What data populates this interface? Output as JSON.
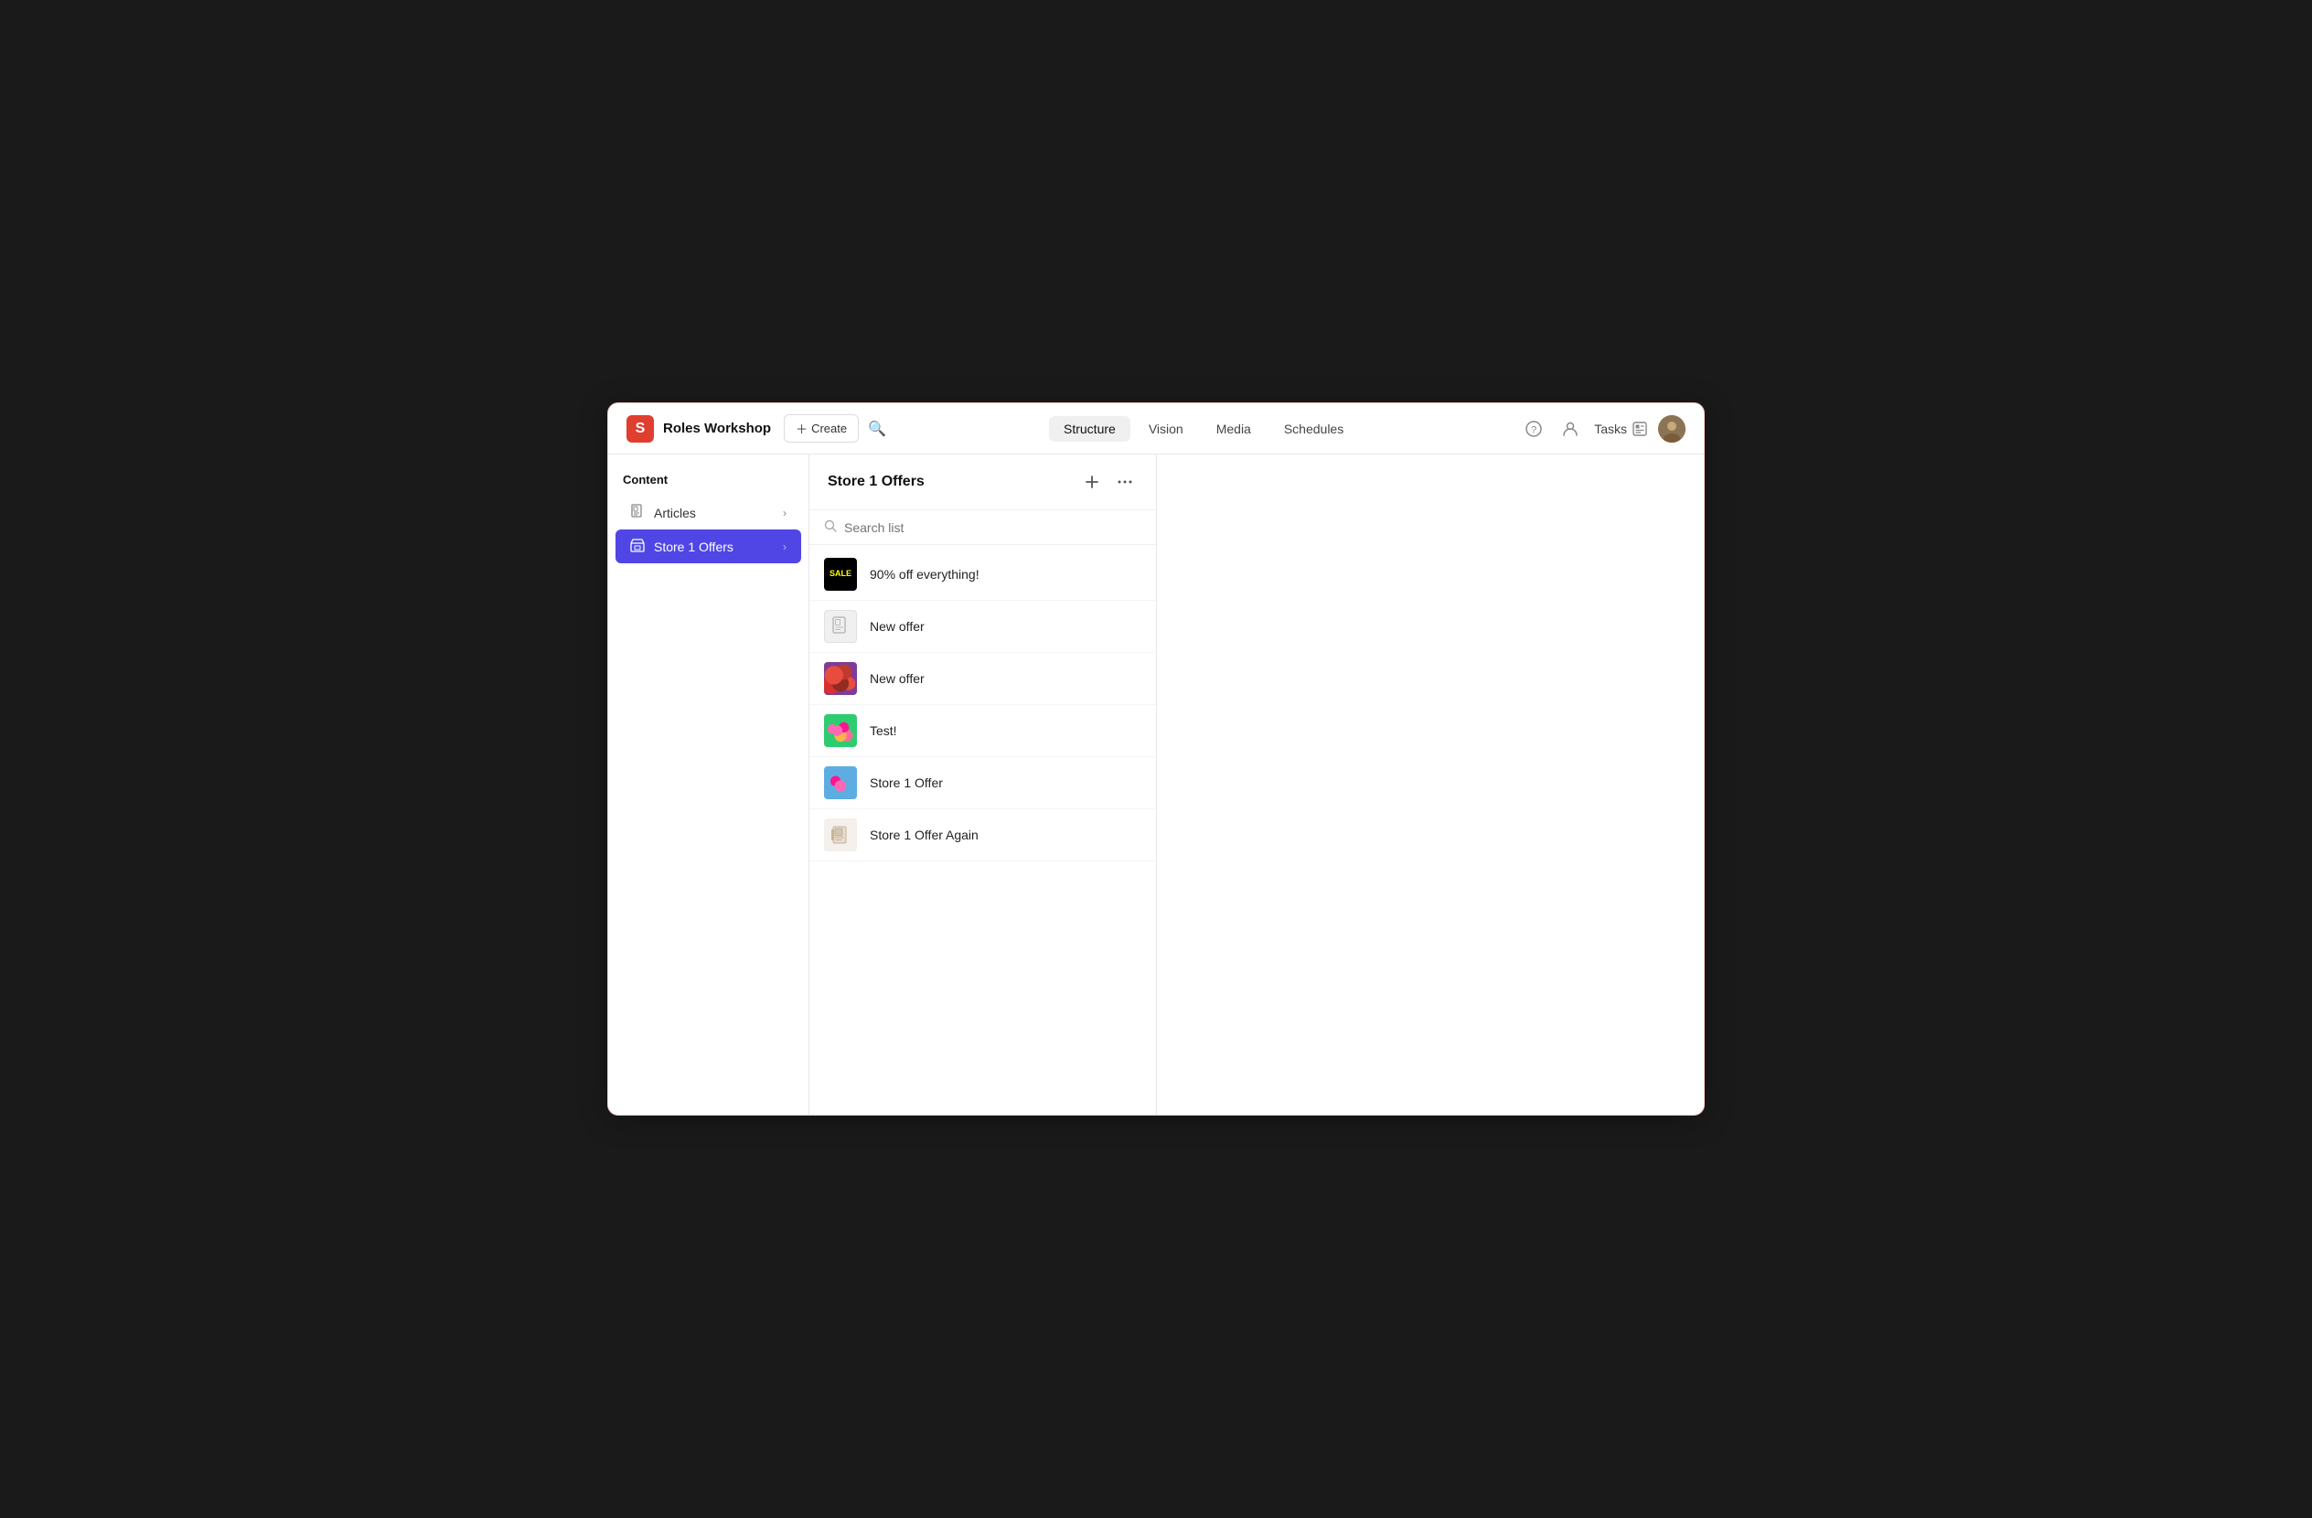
{
  "app": {
    "logo": "S",
    "title": "Roles Workshop",
    "create_label": "+ Create",
    "tasks_label": "Tasks"
  },
  "nav": {
    "tabs": [
      {
        "label": "Structure",
        "active": true
      },
      {
        "label": "Vision",
        "active": false
      },
      {
        "label": "Media",
        "active": false
      },
      {
        "label": "Schedules",
        "active": false
      }
    ]
  },
  "sidebar": {
    "section_title": "Content",
    "items": [
      {
        "label": "Articles",
        "active": false
      },
      {
        "label": "Store 1 Offers",
        "active": true
      }
    ]
  },
  "content_panel": {
    "title": "Store 1 Offers",
    "search_placeholder": "Search list",
    "add_icon": "+",
    "more_icon": "•••",
    "offers": [
      {
        "id": 1,
        "name": "90% off everything!",
        "thumb_type": "sale"
      },
      {
        "id": 2,
        "name": "New offer",
        "thumb_type": "blank"
      },
      {
        "id": 3,
        "name": "New offer",
        "thumb_type": "berries"
      },
      {
        "id": 4,
        "name": "Test!",
        "thumb_type": "flowers"
      },
      {
        "id": 5,
        "name": "Store 1 Offer",
        "thumb_type": "teal"
      },
      {
        "id": 6,
        "name": "Store 1 Offer Again",
        "thumb_type": "notebook"
      }
    ]
  }
}
